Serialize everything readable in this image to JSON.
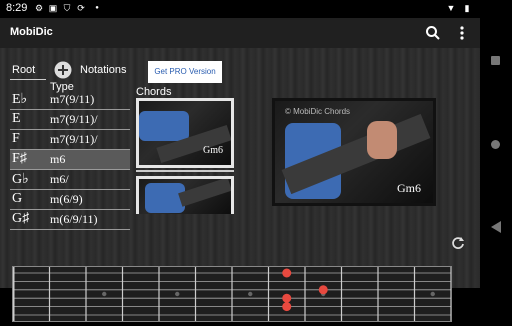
{
  "status": {
    "time": "8:29"
  },
  "appbar": {
    "title": "MobiDic"
  },
  "header": {
    "root_label": "Root",
    "notations_label": "Notations",
    "type_label": "Type",
    "pro_label": "Get PRO Version",
    "chords_label": "Chords"
  },
  "rows": [
    {
      "root": "E♭",
      "type": "m7(9/11)"
    },
    {
      "root": "E",
      "type": "m7(9/11)/"
    },
    {
      "root": "F",
      "type": "m7(9/11)/"
    },
    {
      "root": "F♯",
      "type": "m6"
    },
    {
      "root": "G♭",
      "type": "m6/"
    },
    {
      "root": "G",
      "type": "m(6/9)"
    },
    {
      "root": "G♯",
      "type": "m(6/9/11)"
    }
  ],
  "selected_index": 3,
  "chord": {
    "name": "Gm6",
    "watermark": "© MobiDic Chords"
  },
  "colors": {
    "appbar": "#202020",
    "note": "#e8493f",
    "selected": "#5a5a5a"
  },
  "icons": [
    "settings-icon",
    "notification-icon",
    "shield-icon",
    "sync-icon",
    "dot-icon",
    "wifi-icon",
    "battery-icon",
    "search-icon",
    "more-vert-icon",
    "add-circle-icon",
    "refresh-icon",
    "nav-square-icon",
    "nav-circle-icon",
    "nav-back-icon"
  ]
}
